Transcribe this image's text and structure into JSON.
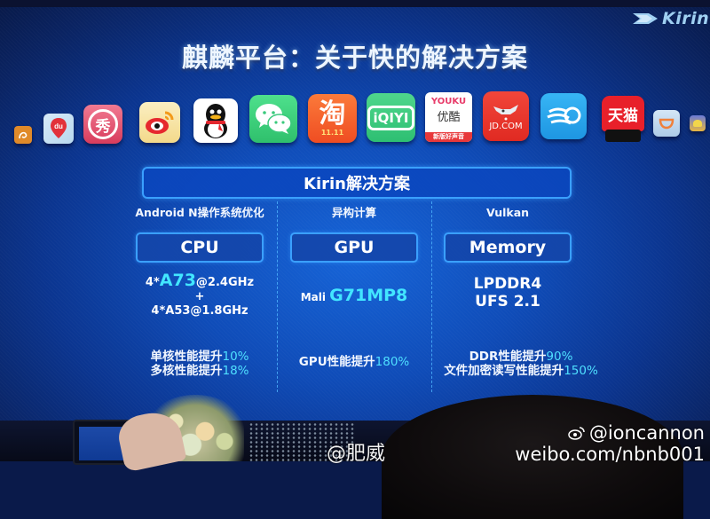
{
  "logo": {
    "text": "Kirin",
    "icon": "kirin-arrow-icon"
  },
  "title": "麒麟平台：关于快的解决方案",
  "app_icons": [
    {
      "name": "uc-browser",
      "label": "",
      "color": "#e08a2a"
    },
    {
      "name": "baidu-map",
      "label": "du",
      "color": "#cfe3f5"
    },
    {
      "name": "meitu-xiuxiu",
      "label": "秀",
      "color": "#e04a6a"
    },
    {
      "name": "weibo",
      "label": "",
      "color": "#f6e6b0"
    },
    {
      "name": "qq",
      "label": "",
      "color": "#ffffff"
    },
    {
      "name": "wechat",
      "label": "",
      "color": "#3fd07a"
    },
    {
      "name": "taobao",
      "label": "淘",
      "sub": "11.11",
      "color": "#f25a2a"
    },
    {
      "name": "iqiyi",
      "label": "iQIYI",
      "color": "#38c77a"
    },
    {
      "name": "youku",
      "label": "YOUKU",
      "label2": "优酷",
      "sub": "新版好声音",
      "color": "#ffffff"
    },
    {
      "name": "jd",
      "label": "JD.COM",
      "color": "#e8322a"
    },
    {
      "name": "moji-weather",
      "label": "",
      "color": "#2aa6ee"
    },
    {
      "name": "tmall",
      "label": "天猫",
      "color": "#e8202a"
    },
    {
      "name": "didi",
      "label": "",
      "color": "#bcd6ee"
    },
    {
      "name": "game-app",
      "label": "",
      "color": "#e8b640"
    }
  ],
  "banner": "Kirin解决方案",
  "columns": [
    {
      "subtitle": "Android N操作系统优化",
      "box": "CPU",
      "spec": {
        "line1_prefix": "4*",
        "line1_highlight": "A73",
        "line1_suffix": "@2.4GHz",
        "plus": "+",
        "line2": "4*A53@1.8GHz"
      },
      "perf": [
        {
          "text": "单核性能提升",
          "value": "10%"
        },
        {
          "text": "多核性能提升",
          "value": "18%"
        }
      ]
    },
    {
      "subtitle": "异构计算",
      "box": "GPU",
      "spec": {
        "prefix": "Mali ",
        "highlight": "G71MP8"
      },
      "perf": [
        {
          "text": "GPU性能提升",
          "value": "180%"
        }
      ]
    },
    {
      "subtitle": "Vulkan",
      "box": "Memory",
      "spec": {
        "line1": "LPDDR4",
        "line2": "UFS 2.1"
      },
      "perf": [
        {
          "text": "DDR性能提升",
          "value": "90%"
        },
        {
          "text": "文件加密读写性能提升",
          "value": "150%"
        }
      ]
    }
  ],
  "watermarks": {
    "left": "@肥威",
    "right_handle": "@ioncannon",
    "right_url": "weibo.com/nbnb001"
  },
  "colors": {
    "accent": "#42e6ff",
    "border": "#3aa0ff",
    "slide_bg": "#0f4cb8"
  }
}
